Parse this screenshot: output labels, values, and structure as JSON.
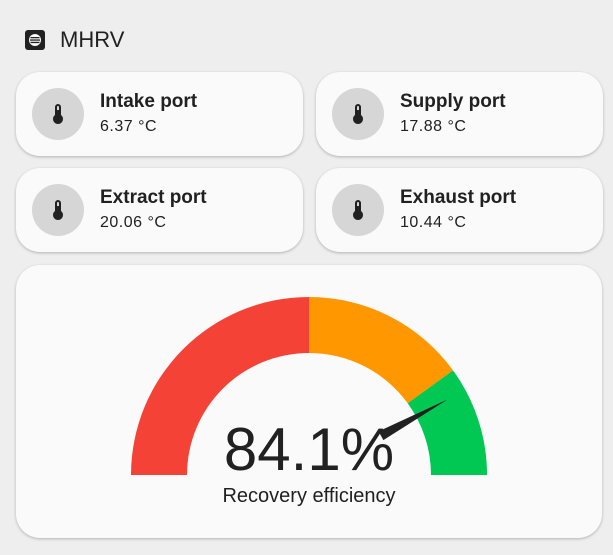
{
  "header": {
    "title": "MHRV",
    "icon": "hrv-fan-icon"
  },
  "tiles": [
    {
      "name": "Intake port",
      "value": "6.37 °C",
      "icon": "thermometer-icon"
    },
    {
      "name": "Supply port",
      "value": "17.88 °C",
      "icon": "thermometer-icon"
    },
    {
      "name": "Extract port",
      "value": "20.06 °C",
      "icon": "thermometer-icon"
    },
    {
      "name": "Exhaust port",
      "value": "10.44 °C",
      "icon": "thermometer-icon"
    }
  ],
  "gauge": {
    "value_text": "84.1%",
    "label": "Recovery efficiency",
    "value": 84.1,
    "min": 0,
    "max": 100,
    "segments": [
      {
        "from": 0,
        "to": 50,
        "color": "#f44336"
      },
      {
        "from": 50,
        "to": 80,
        "color": "#ff9800"
      },
      {
        "from": 80,
        "to": 100,
        "color": "#00c853"
      }
    ],
    "needle_color": "#212121"
  }
}
